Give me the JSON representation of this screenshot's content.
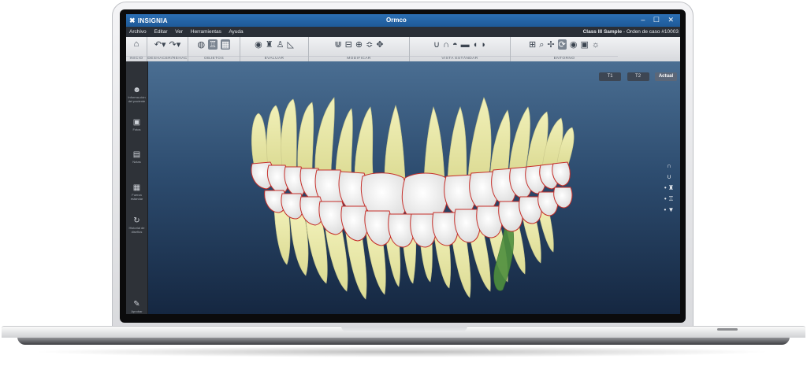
{
  "window": {
    "brand": "INSIGNIA",
    "title": "Ormco",
    "controls": "– ☐ ✕"
  },
  "menu": {
    "items": [
      "Archivo",
      "Editar",
      "Ver",
      "Herramientas",
      "Ayuda"
    ],
    "case_name": "Class III Sample",
    "case_suffix": " - Orden de caso #10003"
  },
  "toolbar": {
    "groups": [
      {
        "label": "INICIO",
        "icons": [
          "home-icon"
        ]
      },
      {
        "label": "DESHACER/REHAC",
        "icons": [
          "undo-icon",
          "redo-icon"
        ]
      },
      {
        "label": "OBJETOS",
        "icons": [
          "objects-icon",
          "tooth-icon",
          "arch-panel-icon"
        ]
      },
      {
        "label": "EVALUAR",
        "icons": [
          "measure-icon",
          "tooth-measure-icon",
          "bite-icon",
          "angle-icon"
        ]
      },
      {
        "label": "MODIFICAR",
        "icons": [
          "arch-modify-icon",
          "ipr-icon",
          "target-icon",
          "teeth-row-icon",
          "move-icon"
        ]
      },
      {
        "label": "VISTA ESTÁNDAR",
        "icons": [
          "upper-view-icon",
          "lower-view-icon",
          "front-view-icon",
          "occlusal-view-icon",
          "left-view-icon",
          "right-view-icon"
        ]
      },
      {
        "label": "ENTORNO",
        "icons": [
          "grid-icon",
          "zoom-icon",
          "pan-icon",
          "rotate-icon",
          "eye-icon",
          "layers-icon",
          "brightness-icon"
        ]
      }
    ]
  },
  "sidebar": {
    "items": [
      {
        "label": "Informa-ción del paciente",
        "icon": "patient-icon"
      },
      {
        "label": "Fotos",
        "icon": "camera-icon"
      },
      {
        "label": "Notas",
        "icon": "notes-icon"
      },
      {
        "label": "Fuerza estándar",
        "icon": "table-icon"
      },
      {
        "label": "Historial de diseños",
        "icon": "history-icon"
      },
      {
        "label": "Aprobar",
        "icon": "approve-icon"
      }
    ]
  },
  "stages": {
    "t1": "T1",
    "t2": "T2",
    "current": "Actual"
  },
  "colors": {
    "title_bar": "#2b6fb4",
    "viewport_top": "#4a6e92",
    "viewport_bottom": "#152741",
    "enamel": "#f2f2f2",
    "root": "#eae9a8",
    "margin_line": "#c62f2a",
    "selected_root": "#5c9a45"
  }
}
